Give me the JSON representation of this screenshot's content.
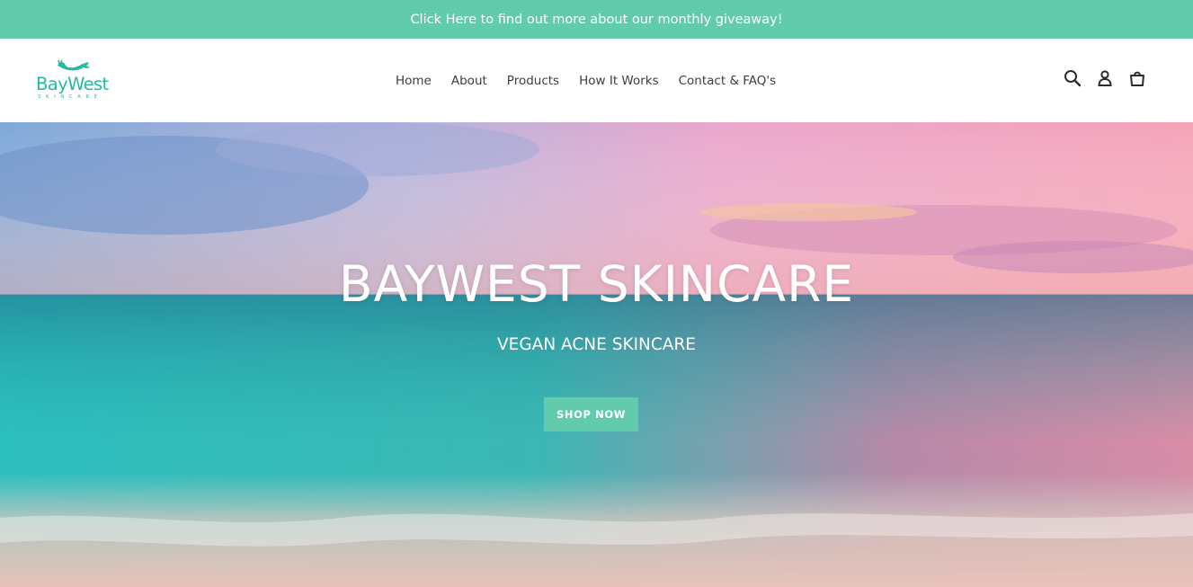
{
  "announcement": {
    "text": "Click Here to find out more about our monthly giveaway!"
  },
  "logo": {
    "wordmark": "BayWest",
    "subtext": "SKINCARE",
    "icon": "whale-tail-icon"
  },
  "nav": {
    "items": [
      {
        "label": "Home"
      },
      {
        "label": "About"
      },
      {
        "label": "Products"
      },
      {
        "label": "How It Works"
      },
      {
        "label": "Contact & FAQ's"
      }
    ]
  },
  "header_icons": [
    "search-icon",
    "account-icon",
    "cart-icon"
  ],
  "hero": {
    "title": "BAYWEST SKINCARE",
    "subtitle": "VEGAN ACNE SKINCARE",
    "button_label": "SHOP NOW",
    "background": "beach-sunset-photo"
  },
  "colors": {
    "accent": "#62cbac",
    "brand": "#29b9a0",
    "nav_text": "#3d3d3d"
  }
}
